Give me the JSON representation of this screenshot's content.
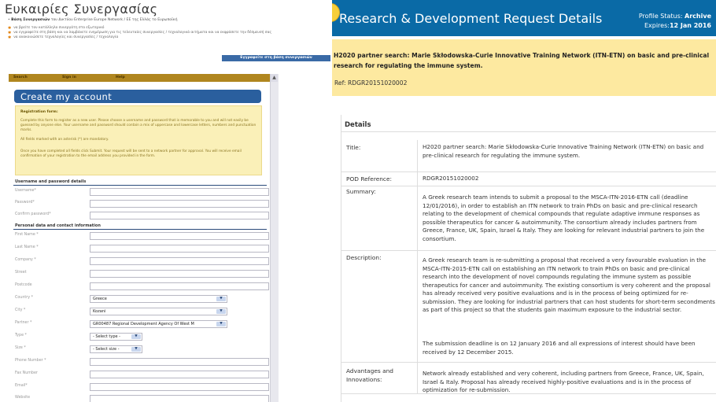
{
  "left": {
    "title": "Ευκαιρίες Συνεργασίας",
    "breadcrumb_home": "Βάση Συνεργασιών",
    "breadcrumb_rest": "του Δικτύου Enterprise Europe Network / ΕΕ της Ελλάς το Ευρωπαϊκή",
    "bullets": [
      "να βρείτε τον κατάλληλο συνεργάτη στο εξωτερικό",
      "να εγγραφείτε στη βάση και να λαμβάνετε ενημέρωση για τις τελευταίες συνεργασίες / τεχνολογικά αιτήματα και να εκφράσετε την δέσμευσή σας",
      "να ανακοινώσετε τεχνολογίες και συνεργασίες / τεχνολογία"
    ],
    "db_button": "Εγγραφείτε στη βάση συνεργασιών",
    "tabs": [
      "Search",
      "Sign in",
      "Help"
    ],
    "create_title": "Create my account",
    "reg_title": "Registration form:",
    "reg_p1": "Complete this form to register as a new user. Please choose a username and password that is memorable to you and will not easily be guessed by anyone else. Your username and password should contain a mix of uppercase and lowercase letters, numbers and punctuation marks.",
    "reg_p2": "All fields marked with an asterisk (*) are mandatory.",
    "reg_p3": "Once you have completed all fields click Submit. Your request will be sent to a network partner for approval. You will receive email confirmation of your registration to the email address you provided in the form.",
    "sec1": "Username and password details",
    "sec2": "Personal data and contact information",
    "fields1": [
      "Username*",
      "Password*",
      "Confirm password*"
    ],
    "fields2": [
      "First Name *",
      "Last Name *",
      "Company *",
      "Street",
      "Postcode"
    ],
    "country_label": "Country *",
    "country_value": "Greece",
    "city_label": "City *",
    "city_value": "Kozani",
    "partner_label": "Partner *",
    "partner_value": "GR00487 Regional Development Agency Of West M",
    "type_label": "Type *",
    "type_value": "- Select type -",
    "size_label": "Size *",
    "size_value": "- Select size -",
    "fields3": [
      "Phone Number *",
      "Fax Number",
      "Email*",
      "Website"
    ]
  },
  "right": {
    "title": "Research & Development Request Details",
    "profile_status_label": "Profile Status:",
    "profile_status_value": "Archive",
    "expires_label": "Expires:",
    "expires_value": "12 Jan 2016",
    "headline": "H2020 partner search: Marie Skłodowska-Curie Innovative Training Network (ITN-ETN) on basic and pre-clinical research for regulating the immune system.",
    "ref": "Ref: RDGR20151020002",
    "details_heading": "Details",
    "rows": [
      {
        "k": "Title:",
        "v": "H2020 partner search: Marie Skłodowska-Curie Innovative Training Network (ITN-ETN) on basic and pre-clinical research for regulating the immune system."
      },
      {
        "k": "POD Reference:",
        "v": "RDGR20151020002"
      },
      {
        "k": "Summary:",
        "v": "A Greek research team intends to submit a proposal to the MSCA-ITN-2016-ETN call (deadline 12/01/2016), in order to establish an ITN network to train PhDs on basic and pre-clinical research relating to the development of chemical compounds that regulate adaptive immune responses as possible therapeutics for cancer & autoimmunity. The consortium already includes partners from Greece, France, UK, Spain, Israel & Italy. They are looking for relevant industrial partners to join the consortium."
      },
      {
        "k": "Description:",
        "v": "A Greek research team is re-submitting a proposal that received a very favourable evaluation in the MSCA-ITN-2015-ETN call on establishing an ITN network to train PhDs on basic and pre-clinical research into the development of novel compounds regulating the immune system as possible therapeutics for cancer and autoimmunity. The existing consortium is very coherent and the proposal has already received very positive evaluations and is in the process of being optimized for re-submission. They are looking for industrial partners that can host students for short-term secondments as part of this project so that the students gain maximum exposure to the industrial sector.",
        "v2": "The submission deadline is on 12 January 2016 and all expressions of interest should have been received by 12 December 2015."
      },
      {
        "k": "Advantages and Innovations:",
        "v": "Network already established and very coherent, including partners from Greece, France, UK, Spain, Israel & Italy. Proposal has already received highly-positive evaluations and is in the process of optimization for re-submission."
      }
    ]
  }
}
